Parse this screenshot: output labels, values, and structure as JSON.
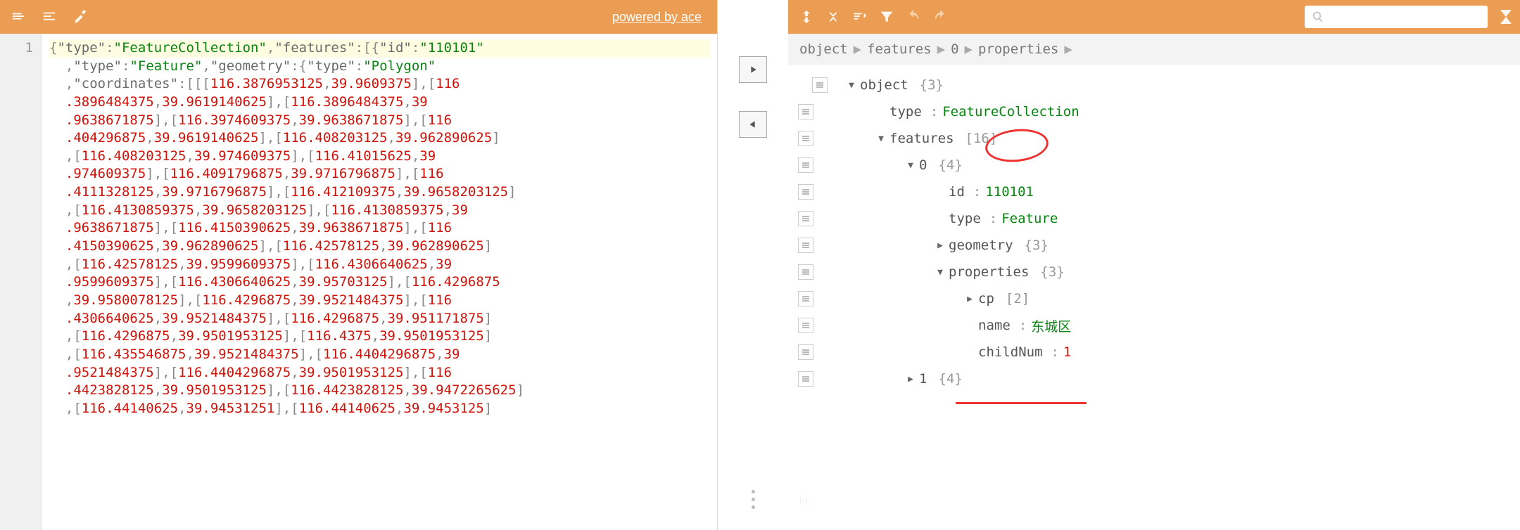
{
  "left_toolbar": {
    "powered_label": "powered by ace"
  },
  "editor": {
    "line_number": "1",
    "tokens": [
      {
        "cls": "hl",
        "parts": [
          {
            "t": "{",
            "c": "p"
          },
          {
            "t": "\"type\"",
            "c": "k"
          },
          {
            "t": ":",
            "c": "p"
          },
          {
            "t": "\"FeatureCollection\"",
            "c": "s"
          },
          {
            "t": ",",
            "c": "p"
          },
          {
            "t": "\"features\"",
            "c": "k"
          },
          {
            "t": ":[{",
            "c": "p"
          },
          {
            "t": "\"id\"",
            "c": "k"
          },
          {
            "t": ":",
            "c": "p"
          },
          {
            "t": "\"110101\"",
            "c": "s"
          }
        ]
      },
      {
        "parts": [
          {
            "t": "  ,",
            "c": "p"
          },
          {
            "t": "\"type\"",
            "c": "k"
          },
          {
            "t": ":",
            "c": "p"
          },
          {
            "t": "\"Feature\"",
            "c": "s"
          },
          {
            "t": ",",
            "c": "p"
          },
          {
            "t": "\"geometry\"",
            "c": "k"
          },
          {
            "t": ":{",
            "c": "p"
          },
          {
            "t": "\"type\"",
            "c": "k"
          },
          {
            "t": ":",
            "c": "p"
          },
          {
            "t": "\"Polygon\"",
            "c": "s"
          }
        ]
      },
      {
        "parts": [
          {
            "t": "  ,",
            "c": "p"
          },
          {
            "t": "\"coordinates\"",
            "c": "k"
          },
          {
            "t": ":[[[",
            "c": "p"
          },
          {
            "t": "116.3876953125",
            "c": "n"
          },
          {
            "t": ",",
            "c": "p"
          },
          {
            "t": "39.9609375",
            "c": "n"
          },
          {
            "t": "],[",
            "c": "p"
          },
          {
            "t": "116",
            "c": "n"
          }
        ]
      },
      {
        "parts": [
          {
            "t": "  .3896484375",
            "c": "n"
          },
          {
            "t": ",",
            "c": "p"
          },
          {
            "t": "39.9619140625",
            "c": "n"
          },
          {
            "t": "],[",
            "c": "p"
          },
          {
            "t": "116.3896484375",
            "c": "n"
          },
          {
            "t": ",",
            "c": "p"
          },
          {
            "t": "39",
            "c": "n"
          }
        ]
      },
      {
        "parts": [
          {
            "t": "  .9638671875",
            "c": "n"
          },
          {
            "t": "],[",
            "c": "p"
          },
          {
            "t": "116.3974609375",
            "c": "n"
          },
          {
            "t": ",",
            "c": "p"
          },
          {
            "t": "39.9638671875",
            "c": "n"
          },
          {
            "t": "],[",
            "c": "p"
          },
          {
            "t": "116",
            "c": "n"
          }
        ]
      },
      {
        "parts": [
          {
            "t": "  .404296875",
            "c": "n"
          },
          {
            "t": ",",
            "c": "p"
          },
          {
            "t": "39.9619140625",
            "c": "n"
          },
          {
            "t": "],[",
            "c": "p"
          },
          {
            "t": "116.408203125",
            "c": "n"
          },
          {
            "t": ",",
            "c": "p"
          },
          {
            "t": "39.962890625",
            "c": "n"
          },
          {
            "t": "]",
            "c": "p"
          }
        ]
      },
      {
        "parts": [
          {
            "t": "  ,[",
            "c": "p"
          },
          {
            "t": "116.408203125",
            "c": "n"
          },
          {
            "t": ",",
            "c": "p"
          },
          {
            "t": "39.974609375",
            "c": "n"
          },
          {
            "t": "],[",
            "c": "p"
          },
          {
            "t": "116.41015625",
            "c": "n"
          },
          {
            "t": ",",
            "c": "p"
          },
          {
            "t": "39",
            "c": "n"
          }
        ]
      },
      {
        "parts": [
          {
            "t": "  .974609375",
            "c": "n"
          },
          {
            "t": "],[",
            "c": "p"
          },
          {
            "t": "116.4091796875",
            "c": "n"
          },
          {
            "t": ",",
            "c": "p"
          },
          {
            "t": "39.9716796875",
            "c": "n"
          },
          {
            "t": "],[",
            "c": "p"
          },
          {
            "t": "116",
            "c": "n"
          }
        ]
      },
      {
        "parts": [
          {
            "t": "  .4111328125",
            "c": "n"
          },
          {
            "t": ",",
            "c": "p"
          },
          {
            "t": "39.9716796875",
            "c": "n"
          },
          {
            "t": "],[",
            "c": "p"
          },
          {
            "t": "116.412109375",
            "c": "n"
          },
          {
            "t": ",",
            "c": "p"
          },
          {
            "t": "39.9658203125",
            "c": "n"
          },
          {
            "t": "]",
            "c": "p"
          }
        ]
      },
      {
        "parts": [
          {
            "t": "  ,[",
            "c": "p"
          },
          {
            "t": "116.4130859375",
            "c": "n"
          },
          {
            "t": ",",
            "c": "p"
          },
          {
            "t": "39.9658203125",
            "c": "n"
          },
          {
            "t": "],[",
            "c": "p"
          },
          {
            "t": "116.4130859375",
            "c": "n"
          },
          {
            "t": ",",
            "c": "p"
          },
          {
            "t": "39",
            "c": "n"
          }
        ]
      },
      {
        "parts": [
          {
            "t": "  .9638671875",
            "c": "n"
          },
          {
            "t": "],[",
            "c": "p"
          },
          {
            "t": "116.4150390625",
            "c": "n"
          },
          {
            "t": ",",
            "c": "p"
          },
          {
            "t": "39.9638671875",
            "c": "n"
          },
          {
            "t": "],[",
            "c": "p"
          },
          {
            "t": "116",
            "c": "n"
          }
        ]
      },
      {
        "parts": [
          {
            "t": "  .4150390625",
            "c": "n"
          },
          {
            "t": ",",
            "c": "p"
          },
          {
            "t": "39.962890625",
            "c": "n"
          },
          {
            "t": "],[",
            "c": "p"
          },
          {
            "t": "116.42578125",
            "c": "n"
          },
          {
            "t": ",",
            "c": "p"
          },
          {
            "t": "39.962890625",
            "c": "n"
          },
          {
            "t": "]",
            "c": "p"
          }
        ]
      },
      {
        "parts": [
          {
            "t": "  ,[",
            "c": "p"
          },
          {
            "t": "116.42578125",
            "c": "n"
          },
          {
            "t": ",",
            "c": "p"
          },
          {
            "t": "39.9599609375",
            "c": "n"
          },
          {
            "t": "],[",
            "c": "p"
          },
          {
            "t": "116.4306640625",
            "c": "n"
          },
          {
            "t": ",",
            "c": "p"
          },
          {
            "t": "39",
            "c": "n"
          }
        ]
      },
      {
        "parts": [
          {
            "t": "  .9599609375",
            "c": "n"
          },
          {
            "t": "],[",
            "c": "p"
          },
          {
            "t": "116.4306640625",
            "c": "n"
          },
          {
            "t": ",",
            "c": "p"
          },
          {
            "t": "39.95703125",
            "c": "n"
          },
          {
            "t": "],[",
            "c": "p"
          },
          {
            "t": "116.4296875",
            "c": "n"
          }
        ]
      },
      {
        "parts": [
          {
            "t": "  ,",
            "c": "p"
          },
          {
            "t": "39.9580078125",
            "c": "n"
          },
          {
            "t": "],[",
            "c": "p"
          },
          {
            "t": "116.4296875",
            "c": "n"
          },
          {
            "t": ",",
            "c": "p"
          },
          {
            "t": "39.9521484375",
            "c": "n"
          },
          {
            "t": "],[",
            "c": "p"
          },
          {
            "t": "116",
            "c": "n"
          }
        ]
      },
      {
        "parts": [
          {
            "t": "  .4306640625",
            "c": "n"
          },
          {
            "t": ",",
            "c": "p"
          },
          {
            "t": "39.9521484375",
            "c": "n"
          },
          {
            "t": "],[",
            "c": "p"
          },
          {
            "t": "116.4296875",
            "c": "n"
          },
          {
            "t": ",",
            "c": "p"
          },
          {
            "t": "39.951171875",
            "c": "n"
          },
          {
            "t": "]",
            "c": "p"
          }
        ]
      },
      {
        "parts": [
          {
            "t": "  ,[",
            "c": "p"
          },
          {
            "t": "116.4296875",
            "c": "n"
          },
          {
            "t": ",",
            "c": "p"
          },
          {
            "t": "39.9501953125",
            "c": "n"
          },
          {
            "t": "],[",
            "c": "p"
          },
          {
            "t": "116.4375",
            "c": "n"
          },
          {
            "t": ",",
            "c": "p"
          },
          {
            "t": "39.9501953125",
            "c": "n"
          },
          {
            "t": "]",
            "c": "p"
          }
        ]
      },
      {
        "parts": [
          {
            "t": "  ,[",
            "c": "p"
          },
          {
            "t": "116.435546875",
            "c": "n"
          },
          {
            "t": ",",
            "c": "p"
          },
          {
            "t": "39.9521484375",
            "c": "n"
          },
          {
            "t": "],[",
            "c": "p"
          },
          {
            "t": "116.4404296875",
            "c": "n"
          },
          {
            "t": ",",
            "c": "p"
          },
          {
            "t": "39",
            "c": "n"
          }
        ]
      },
      {
        "parts": [
          {
            "t": "  .9521484375",
            "c": "n"
          },
          {
            "t": "],[",
            "c": "p"
          },
          {
            "t": "116.4404296875",
            "c": "n"
          },
          {
            "t": ",",
            "c": "p"
          },
          {
            "t": "39.9501953125",
            "c": "n"
          },
          {
            "t": "],[",
            "c": "p"
          },
          {
            "t": "116",
            "c": "n"
          }
        ]
      },
      {
        "parts": [
          {
            "t": "  .4423828125",
            "c": "n"
          },
          {
            "t": ",",
            "c": "p"
          },
          {
            "t": "39.9501953125",
            "c": "n"
          },
          {
            "t": "],[",
            "c": "p"
          },
          {
            "t": "116.4423828125",
            "c": "n"
          },
          {
            "t": ",",
            "c": "p"
          },
          {
            "t": "39.9472265625",
            "c": "n"
          },
          {
            "t": "]",
            "c": "p"
          }
        ]
      },
      {
        "parts": [
          {
            "t": "  ,[",
            "c": "p"
          },
          {
            "t": "116.44140625",
            "c": "n"
          },
          {
            "t": ",",
            "c": "p"
          },
          {
            "t": "39.94531251",
            "c": "n"
          },
          {
            "t": "],[",
            "c": "p"
          },
          {
            "t": "116.44140625",
            "c": "n"
          },
          {
            "t": ",",
            "c": "p"
          },
          {
            "t": "39.9453125",
            "c": "n"
          },
          {
            "t": "]",
            "c": "p"
          }
        ]
      }
    ]
  },
  "breadcrumb": [
    "object",
    "features",
    "0",
    "properties"
  ],
  "tree": [
    {
      "indent": 0,
      "drag": false,
      "box": true,
      "toggle": "▼",
      "key": "object",
      "meta": "{3}"
    },
    {
      "indent": 1,
      "drag": true,
      "box": true,
      "toggle": "",
      "key": "type",
      "colon": true,
      "val": "FeatureCollection",
      "vcls": "val-str"
    },
    {
      "indent": 1,
      "drag": true,
      "box": true,
      "toggle": "▼",
      "key": "features",
      "meta": "[16]"
    },
    {
      "indent": 2,
      "drag": true,
      "box": true,
      "toggle": "▼",
      "key": "0",
      "meta": "{4}"
    },
    {
      "indent": 3,
      "drag": true,
      "box": true,
      "toggle": "",
      "key": "id",
      "colon": true,
      "val": "110101",
      "vcls": "val-str"
    },
    {
      "indent": 3,
      "drag": true,
      "box": true,
      "toggle": "",
      "key": "type",
      "colon": true,
      "val": "Feature",
      "vcls": "val-str"
    },
    {
      "indent": 3,
      "drag": true,
      "box": true,
      "toggle": "▶",
      "key": "geometry",
      "meta": "{3}"
    },
    {
      "indent": 3,
      "drag": true,
      "box": true,
      "toggle": "▼",
      "key": "properties",
      "meta": "{3}"
    },
    {
      "indent": 4,
      "drag": true,
      "box": true,
      "toggle": "▶",
      "key": "cp",
      "meta": "[2]"
    },
    {
      "indent": 4,
      "drag": true,
      "box": true,
      "toggle": "",
      "key": "name",
      "colon": true,
      "val": "东城区",
      "vcls": "val-str"
    },
    {
      "indent": 4,
      "drag": true,
      "box": true,
      "toggle": "",
      "key": "childNum",
      "colon": true,
      "val": "1",
      "vcls": "val-num"
    },
    {
      "indent": 2,
      "drag": true,
      "box": true,
      "toggle": "▶",
      "key": "1",
      "meta": "{4}"
    }
  ],
  "search": {
    "placeholder": ""
  }
}
